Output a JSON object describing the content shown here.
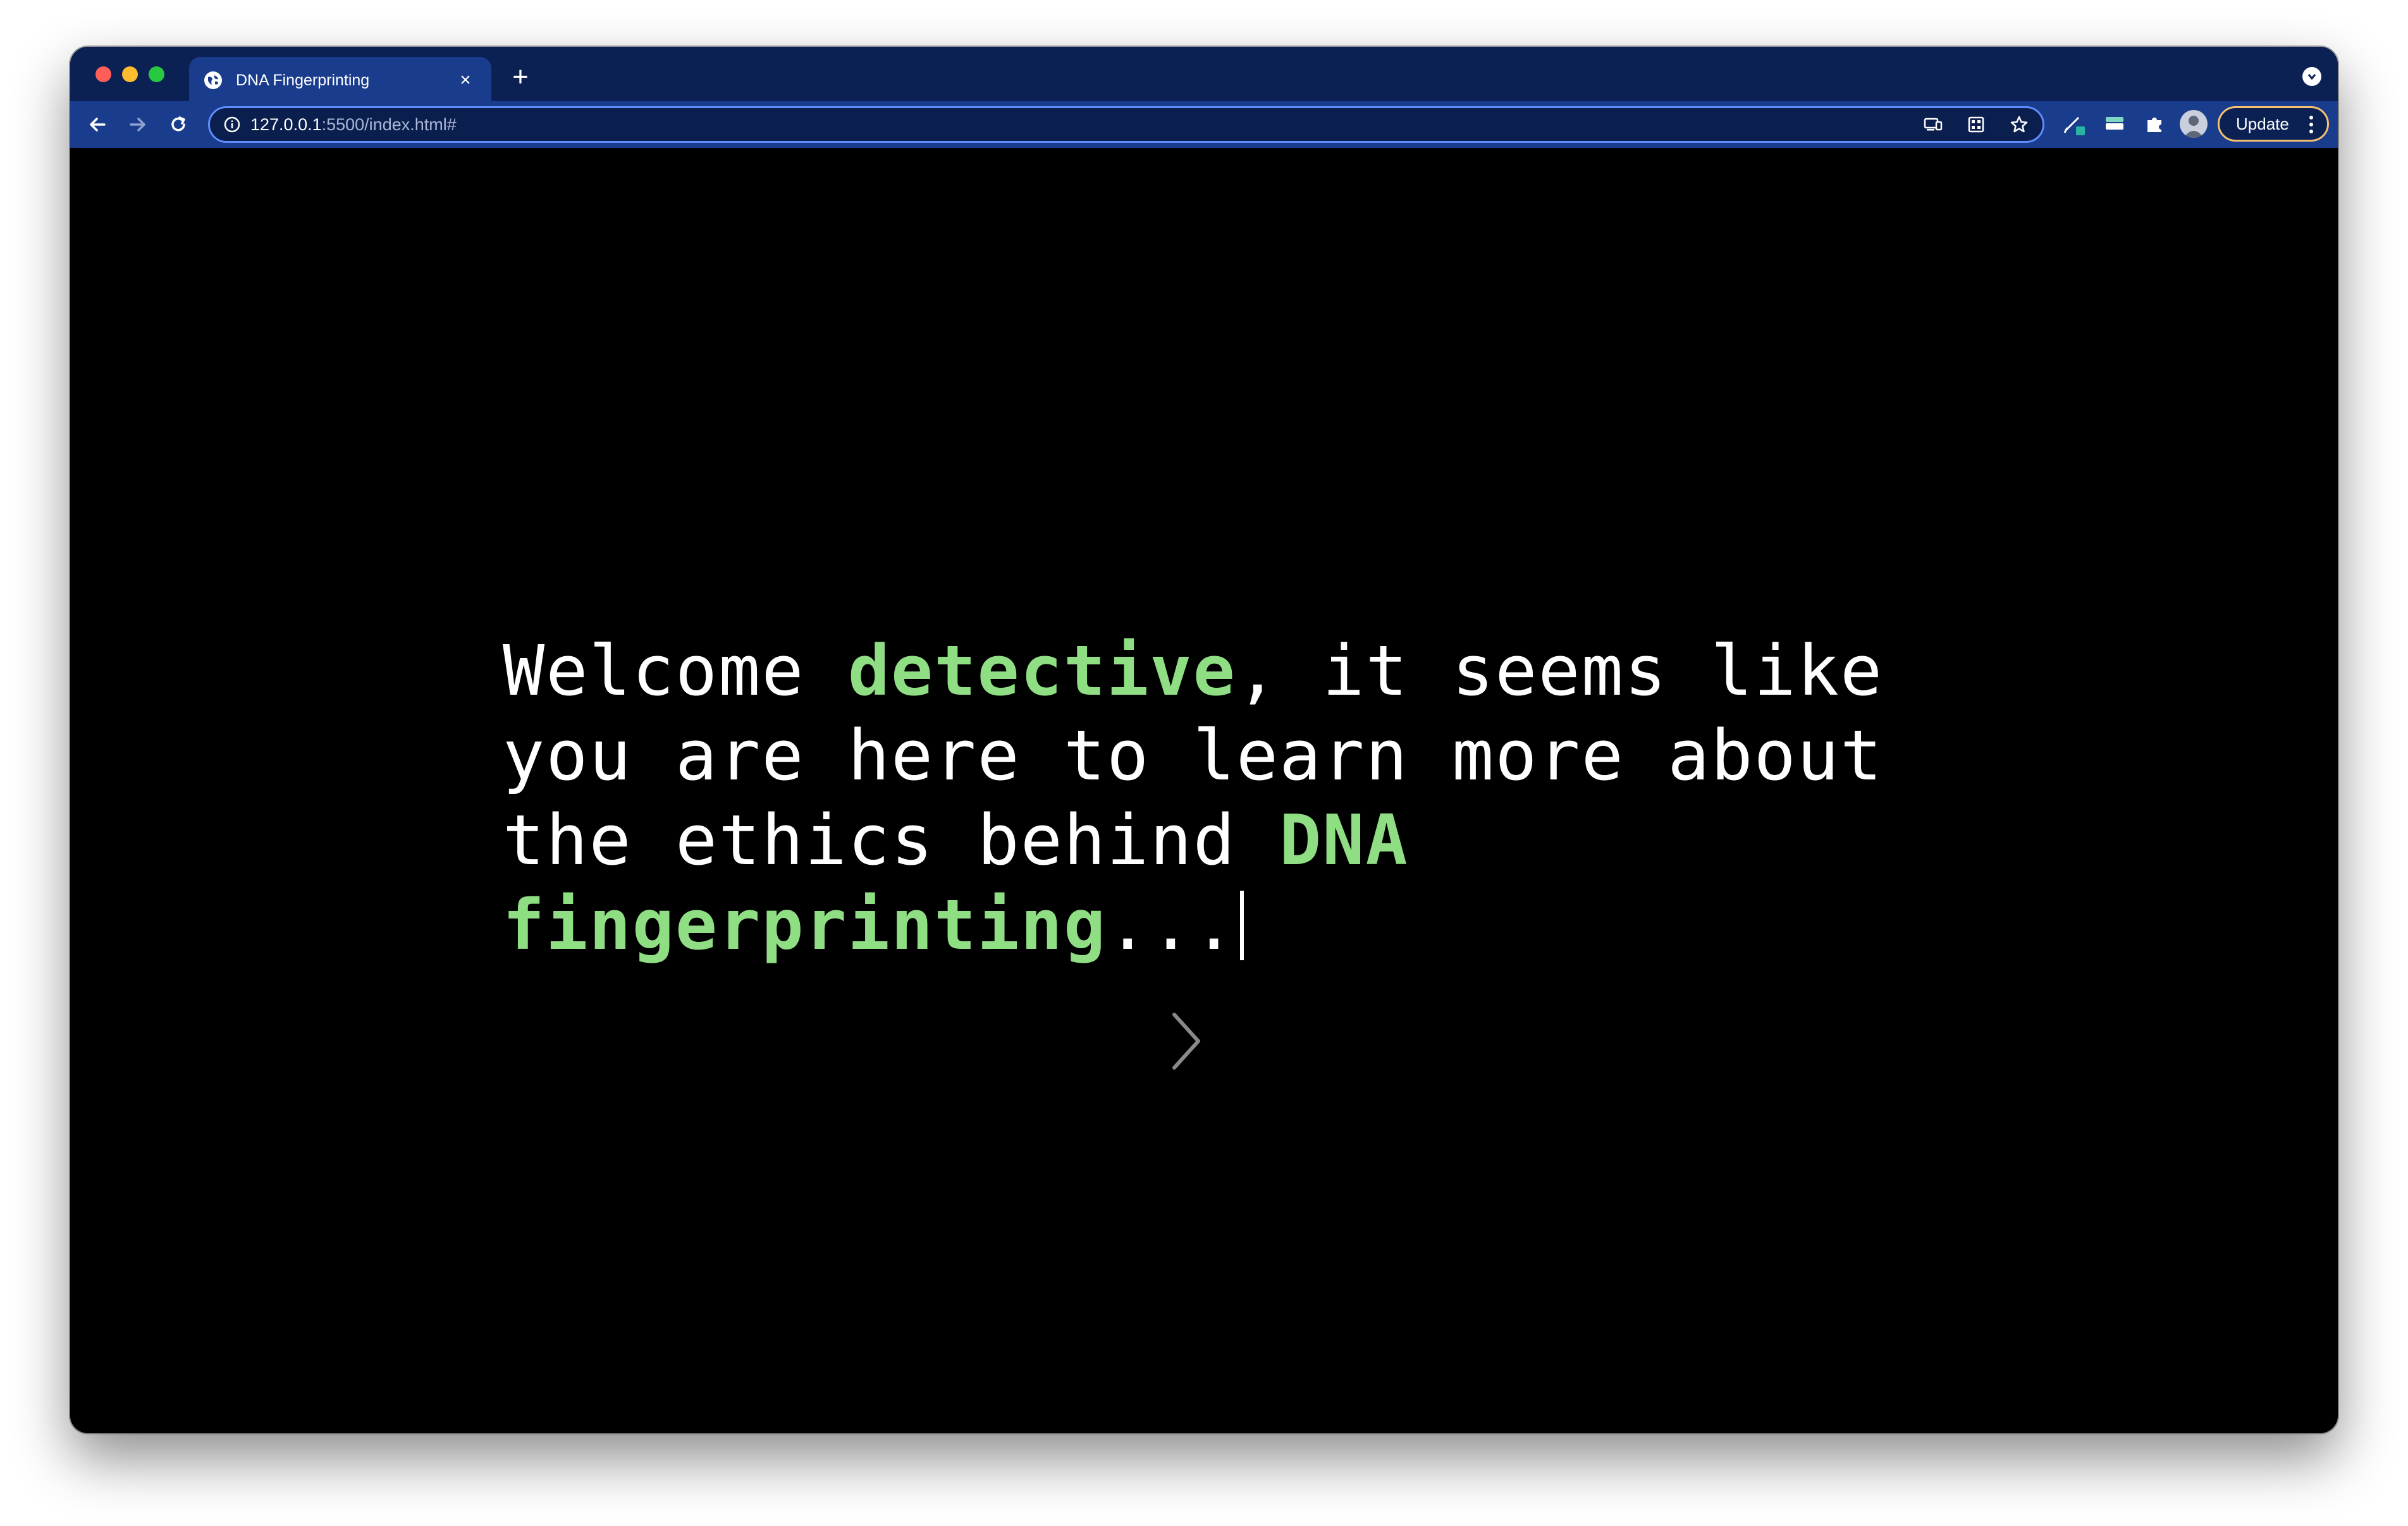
{
  "browser": {
    "tab": {
      "title": "DNA Fingerprinting"
    },
    "omnibox": {
      "url_host": "127.0.0.1",
      "url_rest": ":5500/index.html#"
    },
    "update_label": "Update"
  },
  "page": {
    "message": {
      "part1": "Welcome ",
      "highlight1": "detective",
      "part2": ", it seems like you are here to learn more about the ethics behind ",
      "highlight2": "DNA fingerprinting",
      "part3": "..."
    }
  },
  "colors": {
    "accent_green": "#8fde84",
    "chrome_bg": "#0b2153",
    "toolbar_bg": "#1a3c8c",
    "page_bg": "#000000",
    "update_border": "#f4c271"
  },
  "icons": [
    "globe-icon",
    "close-icon",
    "plus-icon",
    "tab-search-icon",
    "back-arrow-icon",
    "forward-arrow-icon",
    "reload-icon",
    "info-icon",
    "cast-icon",
    "qr-code-icon",
    "star-icon",
    "pen-extension-icon",
    "card-extension-icon",
    "puzzle-icon",
    "profile-avatar",
    "more-vert-icon",
    "chevron-right-icon"
  ]
}
